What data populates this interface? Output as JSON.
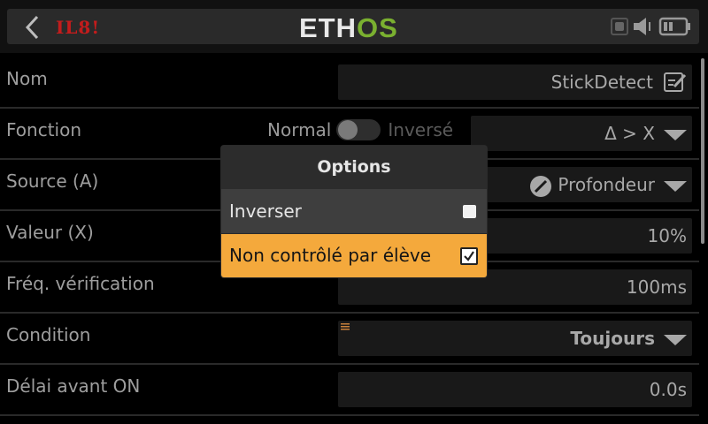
{
  "header": {
    "model_name": "IL8!",
    "logo_part1": "ETH",
    "logo_part2": "OS"
  },
  "rows": [
    {
      "label": "Nom",
      "value": "StickDetect"
    },
    {
      "label": "Fonction",
      "toggle_off_label": "Normal",
      "toggle_on_label": "Inversé",
      "value": "Δ > X"
    },
    {
      "label": "Source (A)",
      "value": "Profondeur"
    },
    {
      "label": "Valeur (X)",
      "value": "10%"
    },
    {
      "label": "Fréq. vérification",
      "value": "100ms"
    },
    {
      "label": "Condition",
      "value": "Toujours"
    },
    {
      "label": "Délai avant ON",
      "value": "0.0s"
    }
  ],
  "dialog": {
    "title": "Options",
    "items": [
      {
        "label": "Inverser",
        "checked": false
      },
      {
        "label": "Non contrôlé par élève",
        "checked": true
      }
    ]
  },
  "colors": {
    "accent": "#f4a93c",
    "model_name": "#c31c1c",
    "logo_os": "#7ab030"
  }
}
